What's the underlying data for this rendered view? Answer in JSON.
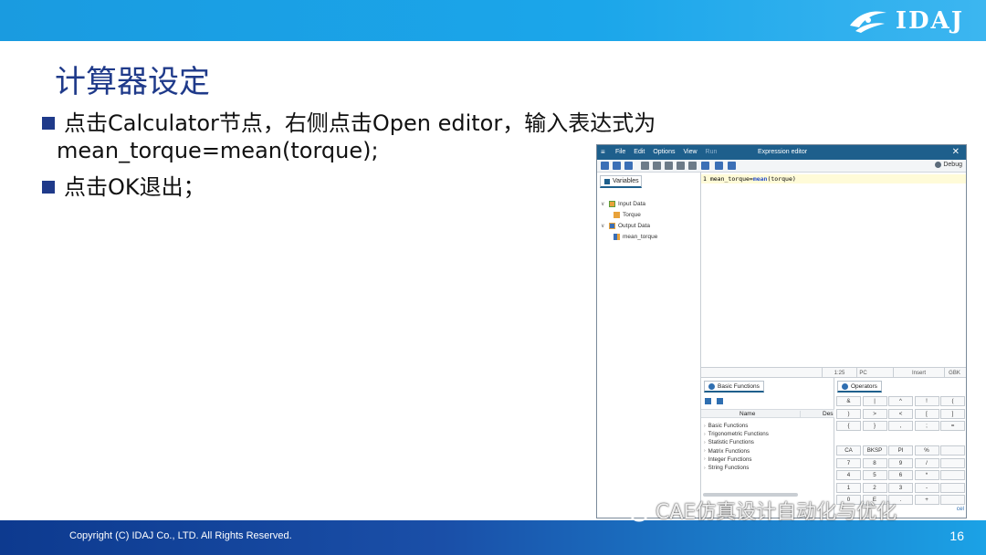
{
  "slide": {
    "title": "计算器设定",
    "bullets": [
      {
        "line1": "点击Calculator节点，右侧点击Open editor，输入表达式为",
        "line2": "mean_torque=mean(torque);"
      },
      {
        "line1": "点击OK退出；"
      }
    ],
    "logo_text": "IDAJ",
    "copyright": "Copyright (C)  IDAJ Co., LTD. All Rights Reserved.",
    "page_number": "16",
    "watermark": "CAE仿真设计自动化与优化"
  },
  "editor_window": {
    "title": "Expression editor",
    "menu": [
      "File",
      "Edit",
      "Options",
      "View",
      "Run"
    ],
    "debug_label": "Debug",
    "variables_tab": "Variables",
    "tree": {
      "input_group": "Input Data",
      "input_item": "Torque",
      "output_group": "Output Data",
      "output_item": "mean_torque"
    },
    "code": {
      "line_no": "1",
      "lhs": "mean_torque=",
      "func": "mean",
      "args": "(torque)"
    },
    "status": {
      "position": "1:25",
      "mode1": "PC",
      "insert": "Insert",
      "encoding": "GBK"
    },
    "basic_functions": {
      "tab": "Basic Functions",
      "col_name": "Name",
      "col_desc": "Des",
      "items": [
        "Basic Functions",
        "Trigonometric Functions",
        "Statistic Functions",
        "Matrix Functions",
        "Integer Functions",
        "String Functions"
      ]
    },
    "operators": {
      "tab": "Operators",
      "rows": [
        [
          "&",
          "|",
          "^",
          "!",
          "("
        ],
        [
          ")",
          ">",
          "<",
          "[",
          "]"
        ],
        [
          "{",
          "}",
          ",",
          ";",
          "="
        ],
        [
          "CA",
          "BKSP",
          "PI",
          "%",
          ""
        ],
        [
          "7",
          "8",
          "9",
          "/",
          ""
        ],
        [
          "4",
          "5",
          "6",
          "*",
          ""
        ],
        [
          "1",
          "2",
          "3",
          "-",
          ""
        ],
        [
          "0",
          "E",
          ".",
          "+",
          ""
        ]
      ],
      "cancel_fragment": "cel"
    }
  },
  "colors": {
    "title_blue": "#1f3a8a",
    "window_titlebar": "#1e5f8c",
    "topbar": "#1ba6ea",
    "footer": "#0d3a8f"
  }
}
